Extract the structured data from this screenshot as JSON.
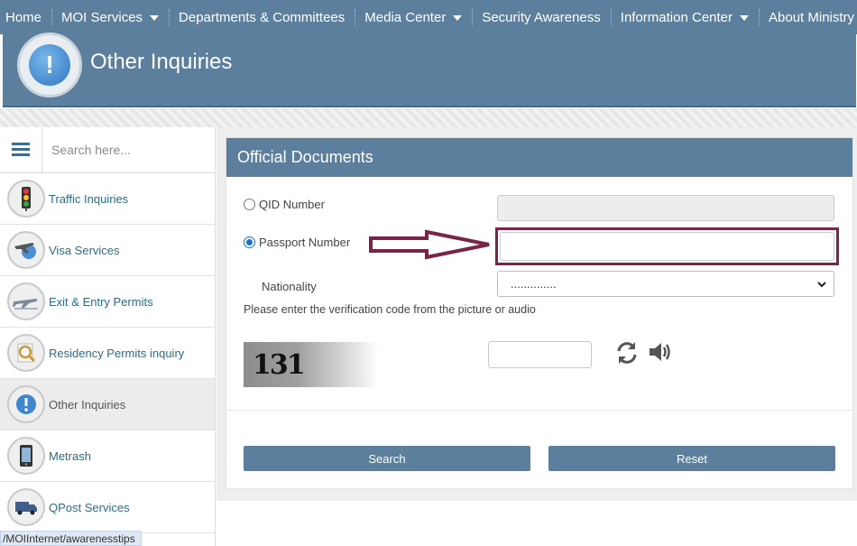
{
  "nav": {
    "items": [
      {
        "label": "Home",
        "dropdown": false
      },
      {
        "label": "MOI Services",
        "dropdown": true
      },
      {
        "label": "Departments & Committees",
        "dropdown": false
      },
      {
        "label": "Media Center",
        "dropdown": true
      },
      {
        "label": "Security Awareness",
        "dropdown": false
      },
      {
        "label": "Information Center",
        "dropdown": true
      },
      {
        "label": "About Ministry",
        "dropdown": true
      }
    ]
  },
  "header": {
    "title": "Other Inquiries",
    "icon": "exclamation-bubble-icon"
  },
  "sidebar": {
    "search_placeholder": "Search here...",
    "items": [
      {
        "label": "Traffic Inquiries",
        "icon": "traffic-light-icon"
      },
      {
        "label": "Visa Services",
        "icon": "airplane-globe-icon"
      },
      {
        "label": "Exit & Entry Permits",
        "icon": "airplane-icon"
      },
      {
        "label": "Residency Permits inquiry",
        "icon": "magnifier-icon"
      },
      {
        "label": "Other Inquiries",
        "icon": "exclamation-bubble-icon",
        "active": true
      },
      {
        "label": "Metrash",
        "icon": "phone-icon"
      },
      {
        "label": "QPost Services",
        "icon": "delivery-truck-icon"
      }
    ]
  },
  "form": {
    "panel_title": "Official Documents",
    "qid_label": "QID Number",
    "passport_label": "Passport Number",
    "passport_selected": true,
    "qid_value": "",
    "passport_value": "",
    "nationality_label": "Nationality",
    "nationality_value": "..............",
    "verify_text": "Please enter the verification code from the picture or audio",
    "captcha_text": "131",
    "captcha_value": "",
    "search_button": "Search",
    "reset_button": "Reset"
  },
  "colors": {
    "brand": "#5b7f9c",
    "highlight": "#7a2449"
  },
  "status_bar": {
    "url": "/MOIInternet/awarenesstips"
  }
}
